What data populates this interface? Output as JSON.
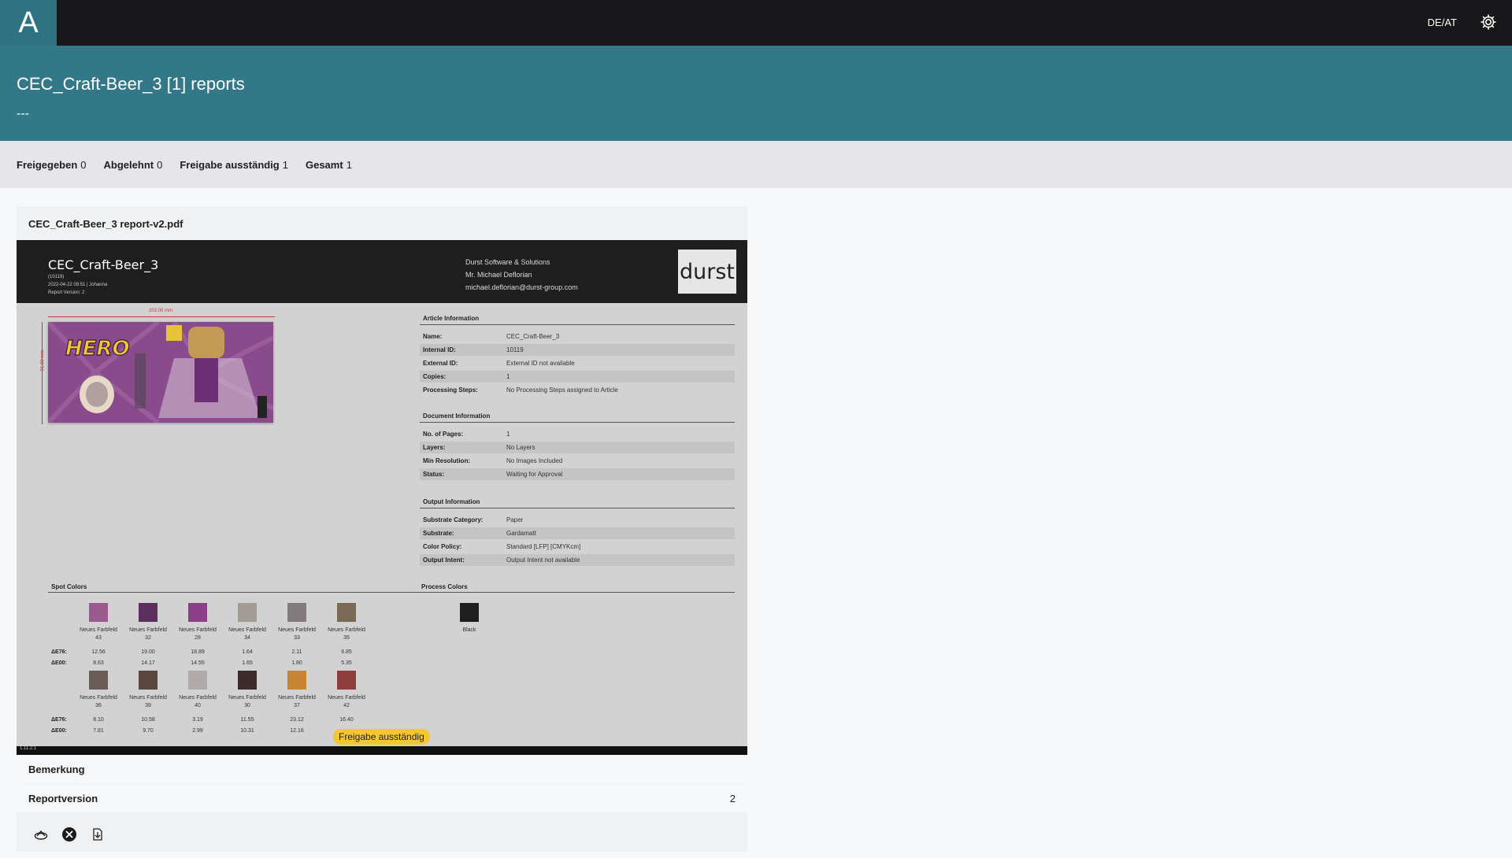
{
  "app": {
    "logo_letter": "A",
    "locale": "DE/AT",
    "settings_icon": "gear-icon"
  },
  "header": {
    "title": "CEC_Craft-Beer_3 [1] reports",
    "subtitle": "---"
  },
  "stats": [
    {
      "label": "Freigegeben",
      "value": "0"
    },
    {
      "label": "Abgelehnt",
      "value": "0"
    },
    {
      "label": "Freigabe ausständig",
      "value": "1"
    },
    {
      "label": "Gesamt",
      "value": "1"
    }
  ],
  "report": {
    "file_name": "CEC_Craft-Beer_3 report-v2.pdf",
    "status_badge": "Freigabe ausständig",
    "remark_label": "Bemerkung",
    "version_label": "Reportversion",
    "version_value": "2",
    "action_icons": [
      "approve-icon",
      "reject-icon",
      "download-icon"
    ]
  },
  "pdf": {
    "article_name": "CEC_Craft-Beer_3",
    "meta": [
      "(10119)",
      "2022-04-22 08:51 | Johanna",
      "Report Version: 2"
    ],
    "contact": [
      "Durst Software & Solutions",
      "Mr. Michael Deflorian",
      "michael.deflorian@durst-group.com"
    ],
    "brand": "durst",
    "dim_width": "203.00 mm",
    "dim_height": "91.00 mm",
    "article_section": "Article Information",
    "article_rows": [
      {
        "k": "Name:",
        "v": "CEC_Craft-Beer_3"
      },
      {
        "k": "Internal ID:",
        "v": "10119"
      },
      {
        "k": "External ID:",
        "v": "External ID not available"
      },
      {
        "k": "Copies:",
        "v": "1"
      },
      {
        "k": "Processing Steps:",
        "v": "No Processing Steps assigned to Article"
      }
    ],
    "document_section": "Document Information",
    "document_rows": [
      {
        "k": "No. of Pages:",
        "v": "1"
      },
      {
        "k": "Layers:",
        "v": "No Layers"
      },
      {
        "k": "Min Resolution:",
        "v": "No Images Included"
      },
      {
        "k": "Status:",
        "v": "Waiting for Approval"
      }
    ],
    "output_section": "Output Information",
    "output_rows": [
      {
        "k": "Substrate Category:",
        "v": "Paper"
      },
      {
        "k": "Substrate:",
        "v": "Gardamatt"
      },
      {
        "k": "Color Policy:",
        "v": "Standard [LFP] [CMYKcm]"
      },
      {
        "k": "Output Intent:",
        "v": "Output Intent not available"
      }
    ],
    "spot_section": "Spot Colors",
    "process_section": "Process Colors",
    "de76_label": "ΔE76:",
    "de00_label": "ΔE00:",
    "spot_row1": [
      {
        "name": "Neues Farbfeld",
        "num": "43",
        "color": "#9a5a8e",
        "de76": "12.56",
        "de00": "8.63"
      },
      {
        "name": "Neues Farbfeld",
        "num": "32",
        "color": "#5c2f5c",
        "de76": "19.00",
        "de00": "14.17"
      },
      {
        "name": "Neues Farbfeld",
        "num": "28",
        "color": "#8a3f86",
        "de76": "18.89",
        "de00": "14.55"
      },
      {
        "name": "Neues Farbfeld",
        "num": "34",
        "color": "#a29e94",
        "de76": "1.64",
        "de00": "1.65"
      },
      {
        "name": "Neues Farbfeld",
        "num": "33",
        "color": "#827a7c",
        "de76": "2.11",
        "de00": "1.80"
      },
      {
        "name": "Neues Farbfeld",
        "num": "35",
        "color": "#7a6a55",
        "de76": "6.85",
        "de00": "5.35"
      }
    ],
    "spot_row2": [
      {
        "name": "Neues Farbfeld",
        "num": "36",
        "color": "#6a5d58",
        "de76": "8.10",
        "de00": "7.81"
      },
      {
        "name": "Neues Farbfeld",
        "num": "39",
        "color": "#5a4740",
        "de76": "10.58",
        "de00": "9.70"
      },
      {
        "name": "Neues Farbfeld",
        "num": "40",
        "color": "#b2aaaa",
        "de76": "3.19",
        "de00": "2.99"
      },
      {
        "name": "Neues Farbfeld",
        "num": "30",
        "color": "#3c2c2c",
        "de76": "11.55",
        "de00": "10.31"
      },
      {
        "name": "Neues Farbfeld",
        "num": "37",
        "color": "#c78432",
        "de76": "23.12",
        "de00": "12.16"
      },
      {
        "name": "Neues Farbfeld",
        "num": "42",
        "color": "#8e3c3c",
        "de76": "16.40",
        "de00": ""
      }
    ],
    "process_colors": [
      {
        "name": "Black",
        "color": "#1e1e1e"
      }
    ],
    "label_art_text": "HERO",
    "footer_version": "1.11.2.1"
  }
}
